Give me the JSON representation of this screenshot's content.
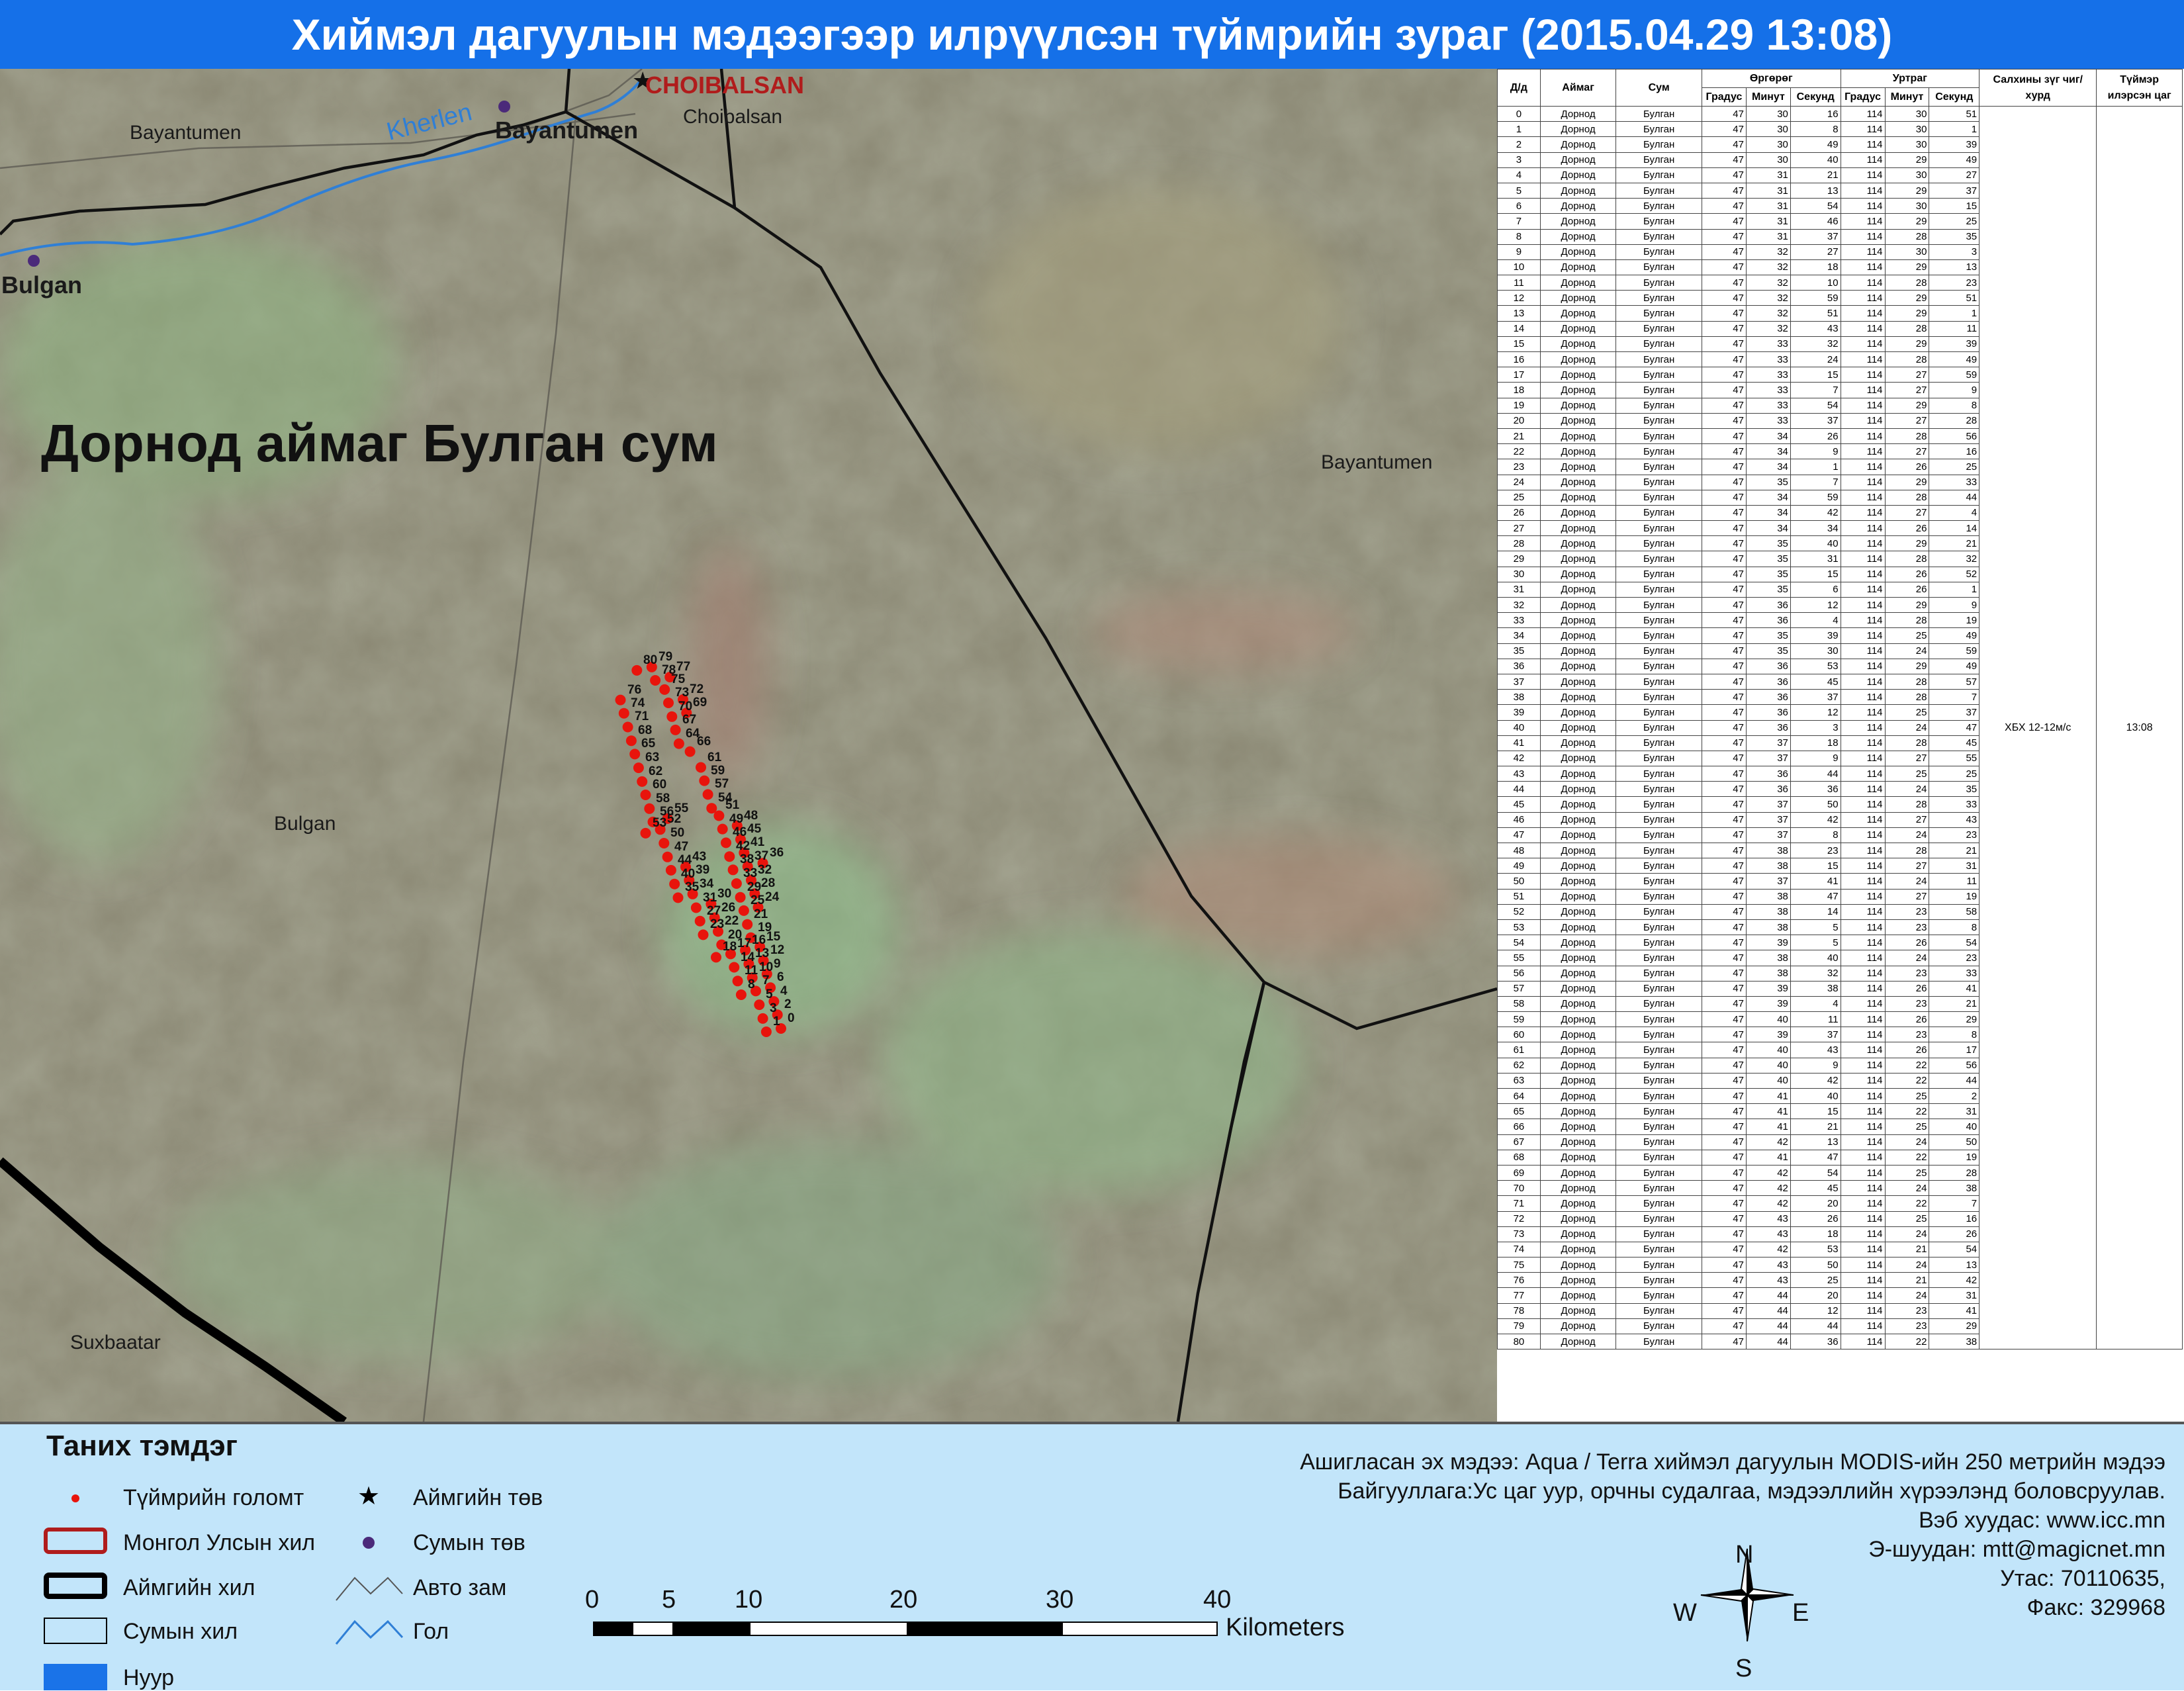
{
  "title": "Хиймэл дагуулын мэдээгээр илрүүлсэн түймрийн зураг  (2015.04.29 13:08)",
  "map": {
    "heading": "Дорнод аймаг Булган сум",
    "places": {
      "choibalsan_city": "CHOIBALSAN",
      "choibalsan_sum": "Choibalsan",
      "bayantumen_center": "Bayantumen",
      "bayantumen_nw": "Bayantumen",
      "bayantumen_east": "Bayantumen",
      "bulgan_center": "Bulgan",
      "bulgan_sum": "Bulgan",
      "suxbaatar": "Suxbaatar",
      "river": "Kherlen"
    },
    "colors": {
      "fire": "#e8140c",
      "river": "#2f7fd6",
      "border": "#111111",
      "terrain": "#8a8670"
    }
  },
  "table": {
    "headers": {
      "id": "Д/д",
      "aimag": "Аймаг",
      "sum": "Сум",
      "lat": "Өргөрөг",
      "lon": "Уртраг",
      "deg": "Градус",
      "min": "Минут",
      "sec": "Секунд",
      "wind": "Салхины зүг чиг/хурд",
      "time": "Түймэр илэрсэн цаг"
    },
    "aimag": "Дорнод",
    "sum": "Булган",
    "wind": "ХБХ 12-12м/с",
    "time": "13:08",
    "rows": [
      [
        0,
        47,
        30,
        16,
        114,
        30,
        51
      ],
      [
        1,
        47,
        30,
        8,
        114,
        30,
        1
      ],
      [
        2,
        47,
        30,
        49,
        114,
        30,
        39
      ],
      [
        3,
        47,
        30,
        40,
        114,
        29,
        49
      ],
      [
        4,
        47,
        31,
        21,
        114,
        30,
        27
      ],
      [
        5,
        47,
        31,
        13,
        114,
        29,
        37
      ],
      [
        6,
        47,
        31,
        54,
        114,
        30,
        15
      ],
      [
        7,
        47,
        31,
        46,
        114,
        29,
        25
      ],
      [
        8,
        47,
        31,
        37,
        114,
        28,
        35
      ],
      [
        9,
        47,
        32,
        27,
        114,
        30,
        3
      ],
      [
        10,
        47,
        32,
        18,
        114,
        29,
        13
      ],
      [
        11,
        47,
        32,
        10,
        114,
        28,
        23
      ],
      [
        12,
        47,
        32,
        59,
        114,
        29,
        51
      ],
      [
        13,
        47,
        32,
        51,
        114,
        29,
        1
      ],
      [
        14,
        47,
        32,
        43,
        114,
        28,
        11
      ],
      [
        15,
        47,
        33,
        32,
        114,
        29,
        39
      ],
      [
        16,
        47,
        33,
        24,
        114,
        28,
        49
      ],
      [
        17,
        47,
        33,
        15,
        114,
        27,
        59
      ],
      [
        18,
        47,
        33,
        7,
        114,
        27,
        9
      ],
      [
        19,
        47,
        33,
        54,
        114,
        29,
        8
      ],
      [
        20,
        47,
        33,
        37,
        114,
        27,
        28
      ],
      [
        21,
        47,
        34,
        26,
        114,
        28,
        56
      ],
      [
        22,
        47,
        34,
        9,
        114,
        27,
        16
      ],
      [
        23,
        47,
        34,
        1,
        114,
        26,
        25
      ],
      [
        24,
        47,
        35,
        7,
        114,
        29,
        33
      ],
      [
        25,
        47,
        34,
        59,
        114,
        28,
        44
      ],
      [
        26,
        47,
        34,
        42,
        114,
        27,
        4
      ],
      [
        27,
        47,
        34,
        34,
        114,
        26,
        14
      ],
      [
        28,
        47,
        35,
        40,
        114,
        29,
        21
      ],
      [
        29,
        47,
        35,
        31,
        114,
        28,
        32
      ],
      [
        30,
        47,
        35,
        15,
        114,
        26,
        52
      ],
      [
        31,
        47,
        35,
        6,
        114,
        26,
        1
      ],
      [
        32,
        47,
        36,
        12,
        114,
        29,
        9
      ],
      [
        33,
        47,
        36,
        4,
        114,
        28,
        19
      ],
      [
        34,
        47,
        35,
        39,
        114,
        25,
        49
      ],
      [
        35,
        47,
        35,
        30,
        114,
        24,
        59
      ],
      [
        36,
        47,
        36,
        53,
        114,
        29,
        49
      ],
      [
        37,
        47,
        36,
        45,
        114,
        28,
        57
      ],
      [
        38,
        47,
        36,
        37,
        114,
        28,
        7
      ],
      [
        39,
        47,
        36,
        12,
        114,
        25,
        37
      ],
      [
        40,
        47,
        36,
        3,
        114,
        24,
        47
      ],
      [
        41,
        47,
        37,
        18,
        114,
        28,
        45
      ],
      [
        42,
        47,
        37,
        9,
        114,
        27,
        55
      ],
      [
        43,
        47,
        36,
        44,
        114,
        25,
        25
      ],
      [
        44,
        47,
        36,
        36,
        114,
        24,
        35
      ],
      [
        45,
        47,
        37,
        50,
        114,
        28,
        33
      ],
      [
        46,
        47,
        37,
        42,
        114,
        27,
        43
      ],
      [
        47,
        47,
        37,
        8,
        114,
        24,
        23
      ],
      [
        48,
        47,
        38,
        23,
        114,
        28,
        21
      ],
      [
        49,
        47,
        38,
        15,
        114,
        27,
        31
      ],
      [
        50,
        47,
        37,
        41,
        114,
        24,
        11
      ],
      [
        51,
        47,
        38,
        47,
        114,
        27,
        19
      ],
      [
        52,
        47,
        38,
        14,
        114,
        23,
        58
      ],
      [
        53,
        47,
        38,
        5,
        114,
        23,
        8
      ],
      [
        54,
        47,
        39,
        5,
        114,
        26,
        54
      ],
      [
        55,
        47,
        38,
        40,
        114,
        24,
        23
      ],
      [
        56,
        47,
        38,
        32,
        114,
        23,
        33
      ],
      [
        57,
        47,
        39,
        38,
        114,
        26,
        41
      ],
      [
        58,
        47,
        39,
        4,
        114,
        23,
        21
      ],
      [
        59,
        47,
        40,
        11,
        114,
        26,
        29
      ],
      [
        60,
        47,
        39,
        37,
        114,
        23,
        8
      ],
      [
        61,
        47,
        40,
        43,
        114,
        26,
        17
      ],
      [
        62,
        47,
        40,
        9,
        114,
        22,
        56
      ],
      [
        63,
        47,
        40,
        42,
        114,
        22,
        44
      ],
      [
        64,
        47,
        41,
        40,
        114,
        25,
        2
      ],
      [
        65,
        47,
        41,
        15,
        114,
        22,
        31
      ],
      [
        66,
        47,
        41,
        21,
        114,
        25,
        40
      ],
      [
        67,
        47,
        42,
        13,
        114,
        24,
        50
      ],
      [
        68,
        47,
        41,
        47,
        114,
        22,
        19
      ],
      [
        69,
        47,
        42,
        54,
        114,
        25,
        28
      ],
      [
        70,
        47,
        42,
        45,
        114,
        24,
        38
      ],
      [
        71,
        47,
        42,
        20,
        114,
        22,
        7
      ],
      [
        72,
        47,
        43,
        26,
        114,
        25,
        16
      ],
      [
        73,
        47,
        43,
        18,
        114,
        24,
        26
      ],
      [
        74,
        47,
        42,
        53,
        114,
        21,
        54
      ],
      [
        75,
        47,
        43,
        50,
        114,
        24,
        13
      ],
      [
        76,
        47,
        43,
        25,
        114,
        21,
        42
      ],
      [
        77,
        47,
        44,
        20,
        114,
        24,
        31
      ],
      [
        78,
        47,
        44,
        12,
        114,
        23,
        41
      ],
      [
        79,
        47,
        44,
        44,
        114,
        23,
        29
      ],
      [
        80,
        47,
        44,
        36,
        114,
        22,
        38
      ]
    ]
  },
  "legend": {
    "title": "Таних тэмдэг",
    "fire": "Түймрийн голомт",
    "aimag_center": "Аймгийн төв",
    "country_border": "Монгол Улсын хил",
    "sum_center": "Сумын төв",
    "aimag_border": "Аймгийн хил",
    "road": "Авто зам",
    "sum_border": "Сумын хил",
    "river": "Гол",
    "lake": "Нуур",
    "colors": {
      "country_border": "#b01c1c",
      "lake": "#1a73e8",
      "sum_center": "#4b2a7a"
    }
  },
  "scalebar": {
    "ticks": [
      "0",
      "5",
      "10",
      "20",
      "30",
      "40"
    ],
    "unit": "Kilometers"
  },
  "compass": {
    "n": "N",
    "s": "S",
    "e": "E",
    "w": "W"
  },
  "credits": {
    "source": "Ашигласан эх мэдээ: Aqua / Terra хиймэл дагуулын MODIS-ийн 250 метрийн мэдээ",
    "organization": "Байгууллага:Ус цаг уур, орчны судалгаа, мэдээллийн хүрээлэнд боловсруулав.",
    "web": "Вэб хуудас: www.icc.mn",
    "email": "Э-шуудан: mtt@magicnet.mn",
    "phone": "Утас: 70110635,",
    "fax": "Факс: 329968"
  }
}
